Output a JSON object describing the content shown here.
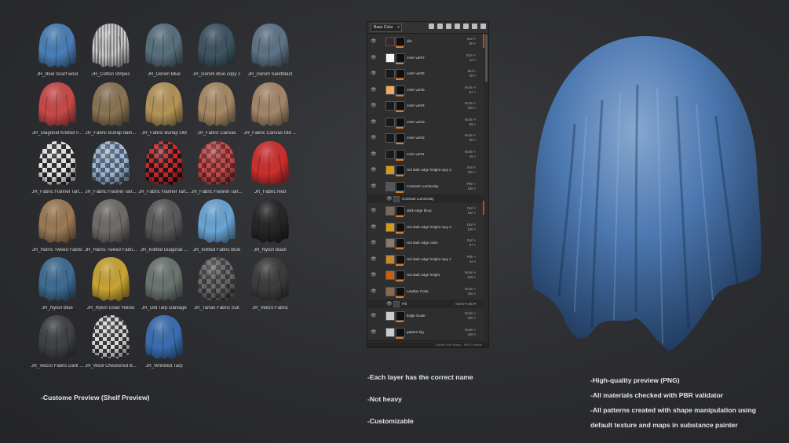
{
  "shelf": {
    "items": [
      {
        "label": "JR_Blue Scarf wool",
        "color": "#4a7fb8",
        "pattern": "plain"
      },
      {
        "label": "JR_Cotton Stripes",
        "color": "#b8b8b8",
        "pattern": "stripes"
      },
      {
        "label": "JR_Denim Blue",
        "color": "#58707f",
        "pattern": "plain"
      },
      {
        "label": "JR_Denim Blue copy 1",
        "color": "#3e5562",
        "pattern": "plain"
      },
      {
        "label": "JR_Denim Sandblast",
        "color": "#5e7487",
        "pattern": "plain"
      },
      {
        "label": "JR_Diagonal Knitted F...",
        "color": "#c94a48",
        "pattern": "plain"
      },
      {
        "label": "JR_Fabric Burlap dam...",
        "color": "#8a7454",
        "pattern": "plain"
      },
      {
        "label": "JR_Fabric Burlap Old",
        "color": "#b59558",
        "pattern": "plain"
      },
      {
        "label": "JR_Fabric Canvas",
        "color": "#a88a66",
        "pattern": "plain"
      },
      {
        "label": "JR_Fabric Canvas Old ...",
        "color": "#a5876a",
        "pattern": "plain"
      },
      {
        "label": "JR_Fabric Flannel Tart...",
        "color": "#d8d8d8",
        "pattern": "checkbw"
      },
      {
        "label": "JR_Fabric Flannel Tart...",
        "color": "#7d93ac",
        "pattern": "checkblue"
      },
      {
        "label": "JR_Fabric Flannel Tart...",
        "color": "#c8282c",
        "pattern": "checkred"
      },
      {
        "label": "JR_Fabric Flannel Tart...",
        "color": "#b54646",
        "pattern": "checkred2"
      },
      {
        "label": "JR_Fabric Red",
        "color": "#cf2f2f",
        "pattern": "plain"
      },
      {
        "label": "JR_Harris Tweed Fabric",
        "color": "#9c7a55",
        "pattern": "plain"
      },
      {
        "label": "JR_Harris Tweed Fabri...",
        "color": "#6f6d6a",
        "pattern": "plain"
      },
      {
        "label": "JR_knitted Diagonal ...",
        "color": "#5a5a5a",
        "pattern": "plain"
      },
      {
        "label": "JR_knitted Fabric Blue",
        "color": "#6aa5d6",
        "pattern": "plain"
      },
      {
        "label": "JR_Nylon black",
        "color": "#262626",
        "pattern": "plain"
      },
      {
        "label": "JR_Nylon Blue",
        "color": "#3e6d93",
        "pattern": "plain"
      },
      {
        "label": "JR_Nylon Used Yellow",
        "color": "#c9a533",
        "pattern": "plain"
      },
      {
        "label": "JR_Old Tarp Damage",
        "color": "#6b7570",
        "pattern": "plain"
      },
      {
        "label": "JR_Tartan Fabric Suit",
        "color": "#5a5a5a",
        "pattern": "checkgray"
      },
      {
        "label": "JR_Velcro Fabric",
        "color": "#3d3d3d",
        "pattern": "plain"
      },
      {
        "label": "JR_Velcro Fabric Dark ...",
        "color": "#404245",
        "pattern": "plain"
      },
      {
        "label": "JR_Wool Checkered B...",
        "color": "#8c8c8c",
        "pattern": "checkbw2"
      },
      {
        "label": "JR_Wrinkled Tarp",
        "color": "#3a6eb2",
        "pattern": "plain"
      }
    ]
  },
  "captions": {
    "shelf": "-Custome Preview (Shelf Preview)",
    "middle": [
      "-Each layer has the correct name",
      "-Not heavy",
      "-Customizable"
    ],
    "right": [
      "-High-quality preview (PNG)",
      "-All materials checked with PBR validator",
      "-All patterns created with shape manipulation using",
      "default texture and maps in substance painter"
    ]
  },
  "layer_panel": {
    "channel": "Base Color",
    "footer": "Cartier Roll Heavy... 80% 2 layers",
    "layers": [
      {
        "name": "dirt",
        "mode": "Ovrl",
        "opacity": "80",
        "swatch": "#3a2a26",
        "sub": false
      },
      {
        "name": "color var07",
        "mode": "Scrn",
        "opacity": "22",
        "swatch": "#f4f4f4",
        "sub": false
      },
      {
        "name": "color var06",
        "mode": "Mul",
        "opacity": "48",
        "swatch": "#1a1a1a",
        "sub": false
      },
      {
        "name": "color var05",
        "mode": "Norm",
        "opacity": "57",
        "swatch": "#f0a862",
        "sub": false
      },
      {
        "name": "color var04",
        "mode": "Norm",
        "opacity": "100",
        "swatch": "#1a1a1a",
        "sub": false
      },
      {
        "name": "color var03",
        "mode": "Norm",
        "opacity": "59",
        "swatch": "#1a1a1a",
        "sub": false
      },
      {
        "name": "color var02",
        "mode": "Norm",
        "opacity": "59",
        "swatch": "#1a1a1a",
        "sub": false
      },
      {
        "name": "color var01",
        "mode": "Norm",
        "opacity": "45",
        "swatch": "#1a1a1a",
        "sub": false
      },
      {
        "name": "red dark edge height copy 2",
        "mode": "Ovrl",
        "opacity": "100",
        "swatch": "#d49a20",
        "sub": false
      },
      {
        "name": "Contrast Luminosity",
        "mode": "Pthr",
        "opacity": "100",
        "swatch": "#555555",
        "sub": false
      },
      {
        "name": "Contrast Luminosity",
        "mode": "",
        "opacity": "",
        "swatch": "#444444",
        "sub": true
      },
      {
        "name": "dark edge blury",
        "mode": "Ovrl",
        "opacity": "100",
        "swatch": "#7a6a5a",
        "sub": false
      },
      {
        "name": "red dark edge height copy 2",
        "mode": "Ovrl",
        "opacity": "100",
        "swatch": "#d49a20",
        "sub": false
      },
      {
        "name": "red dark edge color",
        "mode": "Ovrl",
        "opacity": "57",
        "swatch": "#8a7a6a",
        "sub": false
      },
      {
        "name": "red dark edge height copy 1",
        "mode": "Pthr",
        "opacity": "44",
        "swatch": "#c58a2a",
        "sub": false
      },
      {
        "name": "red dark edge height",
        "mode": "Norm",
        "opacity": "100",
        "swatch": "#c86010",
        "sub": false
      },
      {
        "name": "Leather Color",
        "mode": "Norm",
        "opacity": "100",
        "swatch": "#8a6a4a",
        "sub": false
      },
      {
        "name": "Fill",
        "mode": "Norm",
        "opacity": "100",
        "swatch": "#444444",
        "sub": true
      },
      {
        "name": "Edge Scale",
        "mode": "Norm",
        "opacity": "100",
        "swatch": "#cccccc",
        "sub": false
      },
      {
        "name": "pattern big",
        "mode": "Norm",
        "opacity": "100",
        "swatch": "#cccccc",
        "sub": false
      }
    ]
  },
  "preview": {
    "color": "#4c78b0"
  }
}
